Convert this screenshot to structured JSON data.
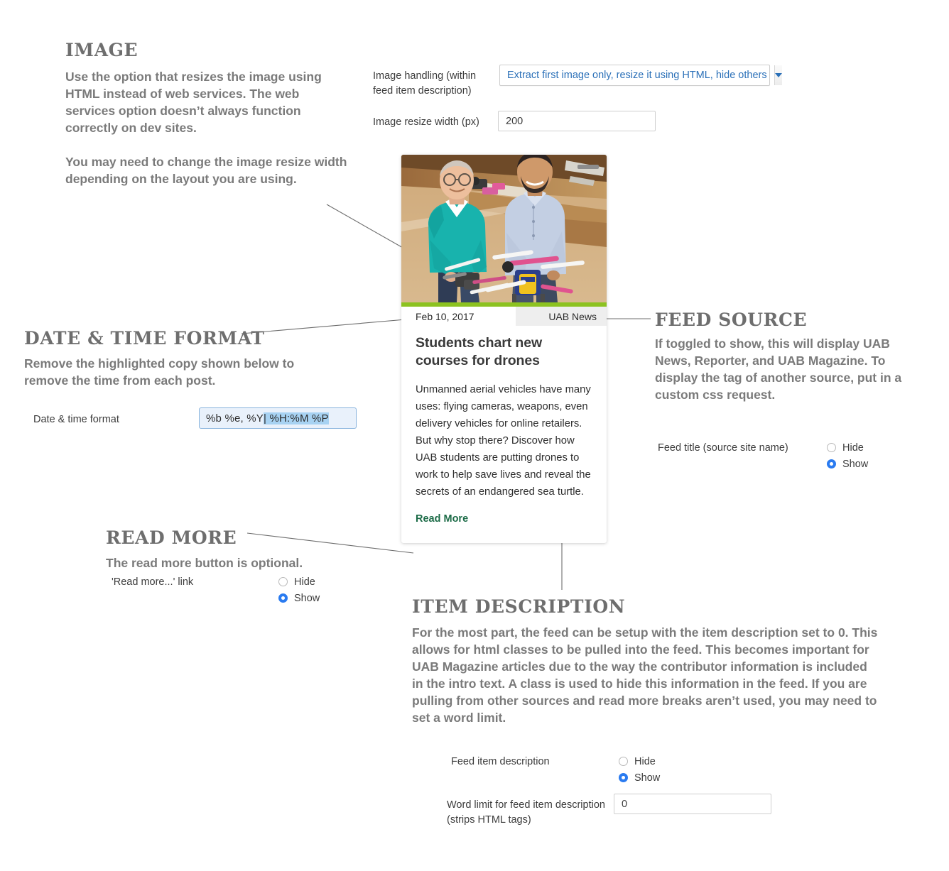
{
  "sections": {
    "image": {
      "heading": "IMAGE",
      "body_1": "Use the option that resizes the image using HTML instead of web services. The web services option doesn’t always function correctly on dev sites.",
      "body_2": "You may need to change the image resize width depending on the layout you are using."
    },
    "date_time": {
      "heading": "DATE & TIME FORMAT",
      "body": "Remove the highlighted copy shown below to remove the time from each post."
    },
    "read_more": {
      "heading": "READ MORE",
      "body": "The read more button is optional."
    },
    "feed_source": {
      "heading": "FEED SOURCE",
      "body": "If toggled to show, this will display UAB News, Reporter, and UAB Magazine. To display the tag of another source, put in a custom css request."
    },
    "item_description": {
      "heading": "ITEM DESCRIPTION",
      "body": "For the most part, the feed can be setup with the item description set to 0.  This allows for html classes to be pulled into the feed.  This becomes important for UAB Magazine articles due to the way the contributor information is included in the intro text.  A class is used to hide this information in the feed.   If you are pulling from other sources and read more breaks aren’t used, you may need to set a word limit."
    }
  },
  "fields": {
    "image_handling": {
      "label": "Image handling (within feed item description)",
      "value": "Extract first image only, resize it using HTML, hide others",
      "icon": "chevron-down-icon"
    },
    "image_resize_width": {
      "label": "Image resize width (px)",
      "value": "200"
    },
    "date_time_format": {
      "label": "Date & time format",
      "value_plain": "%b %e, %Y ",
      "value_selected": "| %H:%M %P"
    },
    "read_more_link": {
      "label": "'Read more...' link",
      "options": [
        "Hide",
        "Show"
      ],
      "selected": "Show"
    },
    "feed_title": {
      "label": "Feed title (source site name)",
      "options": [
        "Hide",
        "Show"
      ],
      "selected": "Show"
    },
    "feed_item_description": {
      "label": "Feed item description",
      "options": [
        "Hide",
        "Show"
      ],
      "selected": "Show"
    },
    "word_limit": {
      "label": "Word limit for feed item description (strips HTML tags)",
      "label_line1": "Word limit for feed item description",
      "label_line2": "(strips HTML tags)",
      "value": "0"
    }
  },
  "card": {
    "photo_alt": "Two men in a workshop holding drone aircraft",
    "date": "Feb 10, 2017",
    "source": "UAB News",
    "title": "Students chart new courses for drones",
    "description": "Unmanned aerial vehicles have many uses: flying cameras, weapons, even delivery vehicles for online retailers. But why stop there? Discover how UAB students are putting drones to work to help save lives and reveal the secrets of an endangered sea turtle.",
    "read_more": "Read More"
  },
  "colors": {
    "heading": "#6e6e6e",
    "body": "#7a7a7a",
    "accent_green": "#8cc220",
    "read_more_green": "#1c6b47",
    "radio_blue": "#2a7bf0",
    "select_link_blue": "#2b70b8",
    "highlight_blue": "#a7d2f2",
    "input_bg_blue": "#e9f1fb",
    "source_tag_bg": "#eeeeee",
    "page_bg": "#ffffff"
  }
}
